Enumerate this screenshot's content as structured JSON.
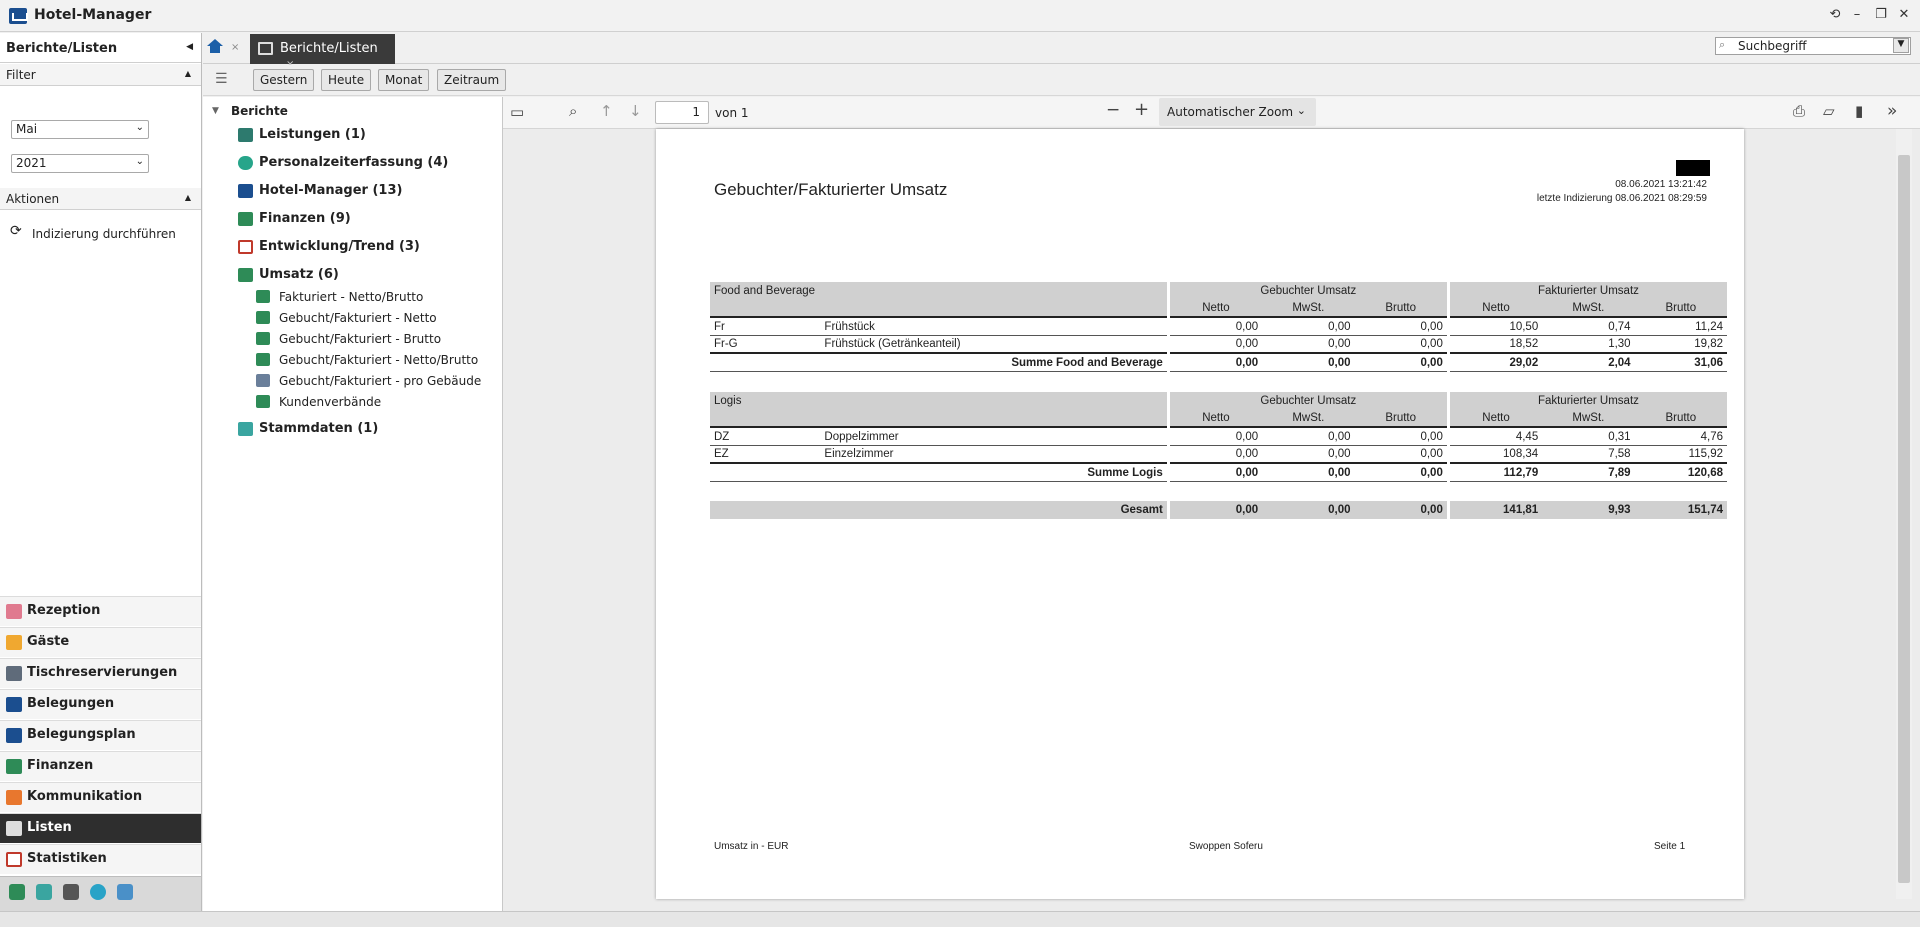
{
  "app": {
    "title": "Hotel-Manager"
  },
  "sidebar": {
    "header": "Berichte/Listen",
    "filter_label": "Filter",
    "month": "Mai",
    "year": "2021",
    "actions_label": "Aktionen",
    "action": "Indizierung durchführen",
    "nav": [
      "Rezeption",
      "Gäste",
      "Tischreservierungen",
      "Belegungen",
      "Belegungsplan",
      "Finanzen",
      "Kommunikation",
      "Listen",
      "Statistiken"
    ]
  },
  "tabs": {
    "active": "Berichte/Listen",
    "close": "×"
  },
  "search": {
    "placeholder": "Suchbegriff"
  },
  "periods": [
    "Gestern",
    "Heute",
    "Monat",
    "Zeitraum"
  ],
  "tree": {
    "root": "Berichte",
    "groups": [
      "Leistungen (1)",
      "Personalzeiterfassung (4)",
      "Hotel-Manager (13)",
      "Finanzen (9)",
      "Entwicklung/Trend (3)",
      "Umsatz (6)"
    ],
    "umsatz_items": [
      "Fakturiert - Netto/Brutto",
      "Gebucht/Fakturiert - Netto",
      "Gebucht/Fakturiert - Brutto",
      "Gebucht/Fakturiert - Netto/Brutto",
      "Gebucht/Fakturiert - pro Gebäude",
      "Kundenverbände"
    ],
    "last": "Stammdaten (1)"
  },
  "viewer": {
    "page": "1",
    "of": "von 1",
    "zoom": "Automatischer Zoom"
  },
  "report": {
    "title": "Gebuchter/Fakturierter Umsatz",
    "date": "08.06.2021 13:21:42",
    "indexed": "letzte Indizierung 08.06.2021 08:29:59",
    "booked": "Gebuchter Umsatz",
    "invoiced": "Fakturierter Umsatz",
    "cols": [
      "Netto",
      "MwSt.",
      "Brutto"
    ],
    "fb": {
      "name": "Food and Beverage",
      "rows": [
        {
          "code": "Fr",
          "label": "Frühstück",
          "v": [
            "0,00",
            "0,00",
            "0,00",
            "10,50",
            "0,74",
            "11,24"
          ]
        },
        {
          "code": "Fr-G",
          "label": "Frühstück (Getränkeanteil)",
          "v": [
            "0,00",
            "0,00",
            "0,00",
            "18,52",
            "1,30",
            "19,82"
          ]
        }
      ],
      "sum_label": "Summe Food and Beverage",
      "sum": [
        "0,00",
        "0,00",
        "0,00",
        "29,02",
        "2,04",
        "31,06"
      ]
    },
    "logis": {
      "name": "Logis",
      "rows": [
        {
          "code": "DZ",
          "label": "Doppelzimmer",
          "v": [
            "0,00",
            "0,00",
            "0,00",
            "4,45",
            "0,31",
            "4,76"
          ]
        },
        {
          "code": "EZ",
          "label": "Einzelzimmer",
          "v": [
            "0,00",
            "0,00",
            "0,00",
            "108,34",
            "7,58",
            "115,92"
          ]
        }
      ],
      "sum_label": "Summe Logis",
      "sum": [
        "0,00",
        "0,00",
        "0,00",
        "112,79",
        "7,89",
        "120,68"
      ]
    },
    "total_label": "Gesamt",
    "total": [
      "0,00",
      "0,00",
      "0,00",
      "141,81",
      "9,93",
      "151,74"
    ],
    "footer_left": "Umsatz in - EUR",
    "footer_mid": "Swoppen Soferu",
    "footer_right": "Seite 1"
  }
}
